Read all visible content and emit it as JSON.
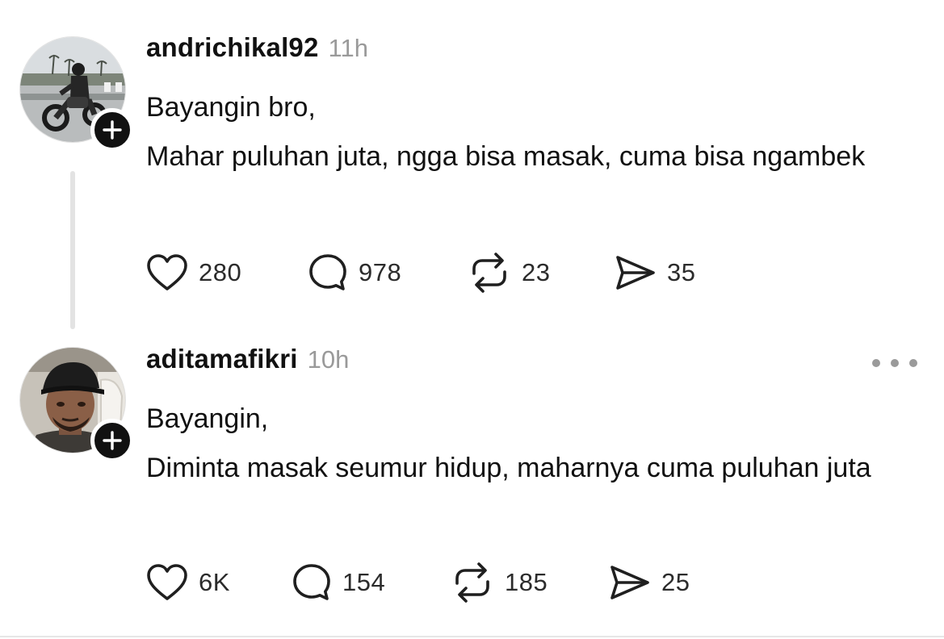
{
  "posts": [
    {
      "username": "andrichikal92",
      "time": "11h",
      "avatar_icon": "motorcycle-rider-avatar",
      "follow_icon": "plus-icon",
      "text": [
        "Bayangin bro,",
        "Mahar puluhan juta, ngga bisa masak, cuma bisa ngambek"
      ],
      "stats": {
        "likes": "280",
        "replies": "978",
        "reposts": "23",
        "shares": "35"
      }
    },
    {
      "username": "aditamafikri",
      "time": "10h",
      "avatar_icon": "man-with-cap-avatar",
      "follow_icon": "plus-icon",
      "more_icon": "more-horizontal-icon",
      "text": [
        "Bayangin,",
        "Diminta masak seumur hidup, maharnya cuma puluhan juta"
      ],
      "stats": {
        "likes": "6K",
        "replies": "154",
        "reposts": "185",
        "shares": "25"
      }
    }
  ],
  "icons": {
    "like": "heart-icon",
    "reply": "comment-bubble-icon",
    "repost": "repost-icon",
    "share": "send-icon"
  },
  "colors": {
    "text": "#111111",
    "muted": "#9a9a9a",
    "thread_line": "#e3e3e3",
    "follow_badge": "#111111"
  }
}
